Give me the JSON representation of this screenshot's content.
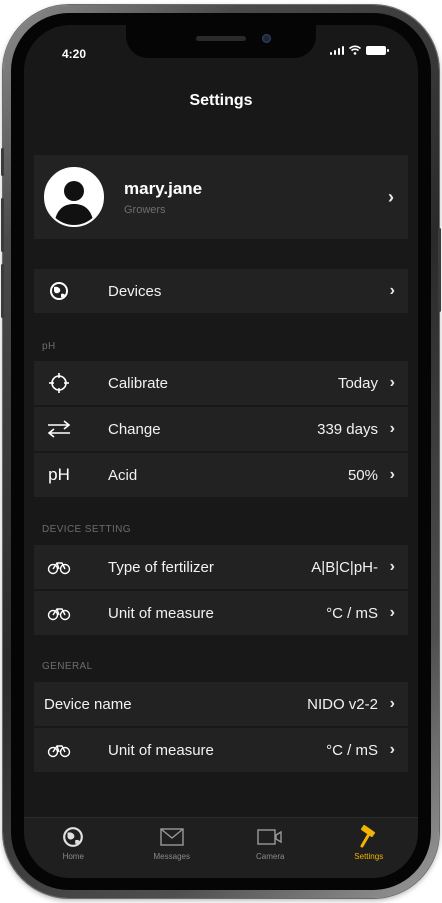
{
  "status_bar": {
    "time": "4:20"
  },
  "nav": {
    "title": "Settings"
  },
  "profile": {
    "name": "mary.jane",
    "subtitle": "Growers"
  },
  "devices_row": {
    "label": "Devices",
    "icon": "devices-globe-icon"
  },
  "sections": {
    "ph": {
      "header": "pH"
    },
    "device_setting": {
      "header": "DEVICE SETTING"
    },
    "general": {
      "header": "GENERAL"
    }
  },
  "ph_rows": [
    {
      "label": "Calibrate",
      "value": "Today",
      "icon": "crosshair-icon"
    },
    {
      "label": "Change",
      "value": "339 days",
      "icon": "swap-arrows-icon"
    },
    {
      "label": "Acid",
      "value": "50%",
      "icon": "ph-text-icon",
      "icon_text": "pH"
    }
  ],
  "device_setting_rows": [
    {
      "label": "Type of fertilizer",
      "value": "A|B|C|pH-",
      "icon": "bicycle-icon"
    },
    {
      "label": "Unit of measure",
      "value": "°C / mS",
      "icon": "bicycle-icon"
    }
  ],
  "general_rows": [
    {
      "label": "Device name",
      "value": "NIDO v2-2"
    },
    {
      "label": "Unit of measure",
      "value": "°C / mS",
      "icon": "bicycle-icon"
    }
  ],
  "tabbar": {
    "items": [
      {
        "label": "Home",
        "icon": "home-globe-icon",
        "active": false
      },
      {
        "label": "Messages",
        "icon": "envelope-icon",
        "active": false
      },
      {
        "label": "Camera",
        "icon": "video-camera-icon",
        "active": false
      },
      {
        "label": "Settings",
        "icon": "hammer-icon",
        "active": true
      }
    ]
  },
  "colors": {
    "accent": "#f1b400",
    "background": "#181818",
    "cell": "#222222",
    "section_text": "#6c6c6c"
  }
}
